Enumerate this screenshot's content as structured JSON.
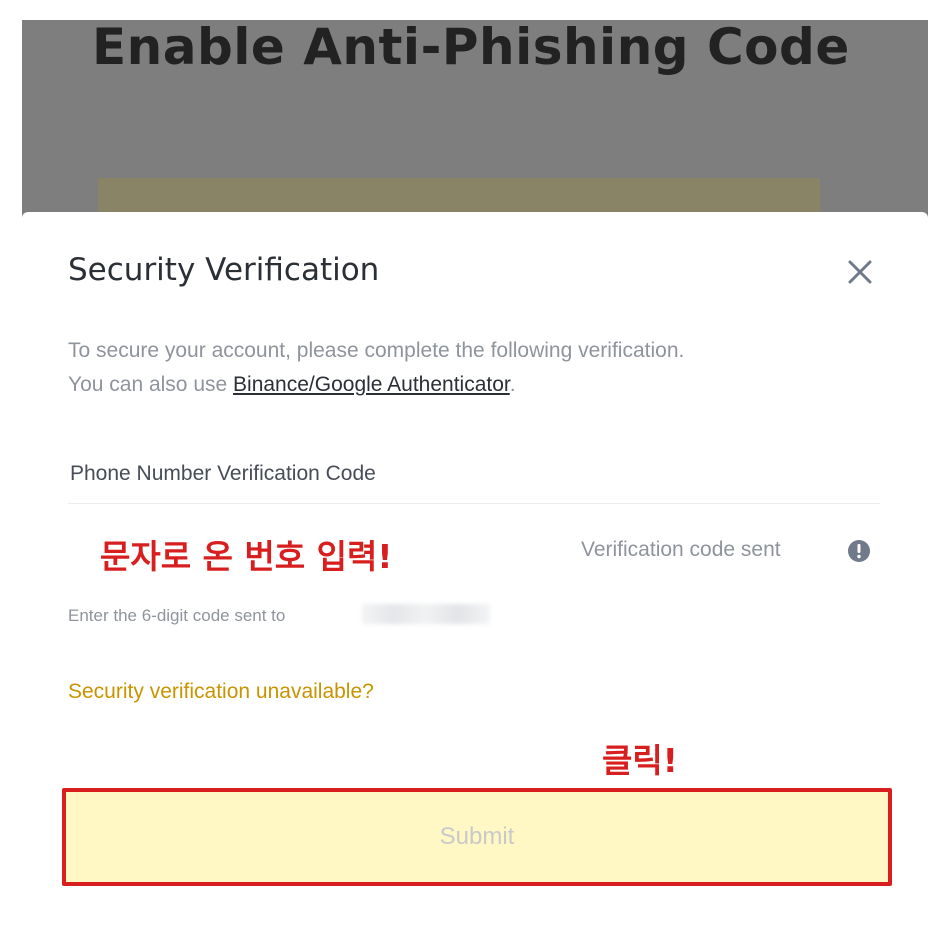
{
  "page": {
    "title": "Enable Anti-Phishing Code"
  },
  "modal": {
    "title": "Security Verification",
    "description_line1": "To secure your account, please complete the following verification.",
    "description_line2_prefix": "You can also use ",
    "authenticator_link": "Binance/Google Authenticator",
    "description_line2_suffix": ".",
    "field_label": "Phone Number Verification Code",
    "code_input_value": "",
    "code_sent_text": "Verification code sent",
    "hint_text": "Enter the 6-digit code sent to",
    "unavailable_link": "Security verification unavailable?",
    "submit_label": "Submit"
  },
  "annotations": {
    "enter_code_note": "문자로 온 번호 입력!",
    "click_note": "클릭!"
  },
  "icons": {
    "close": "close-icon",
    "info": "info-icon"
  },
  "colors": {
    "accent_link": "#c99400",
    "submit_bg": "#fff8c4",
    "annotation_red": "#d81f1f"
  }
}
